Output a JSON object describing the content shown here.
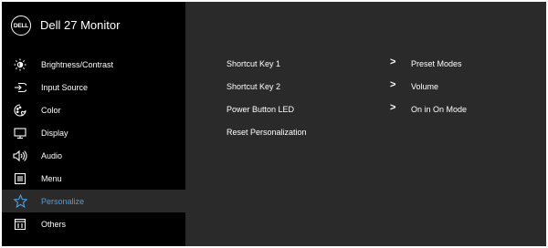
{
  "header": {
    "logo_text": "DELL",
    "title": "Dell 27 Monitor"
  },
  "menu": [
    {
      "label": "Brightness/Contrast",
      "icon": "brightness-icon"
    },
    {
      "label": "Input Source",
      "icon": "input-source-icon"
    },
    {
      "label": "Color",
      "icon": "color-icon"
    },
    {
      "label": "Display",
      "icon": "display-icon"
    },
    {
      "label": "Audio",
      "icon": "audio-icon"
    },
    {
      "label": "Menu",
      "icon": "menu-icon"
    },
    {
      "label": "Personalize",
      "icon": "star-icon",
      "selected": true
    },
    {
      "label": "Others",
      "icon": "others-icon"
    }
  ],
  "panel": {
    "rows": [
      {
        "label": "Shortcut Key 1",
        "arrow": ">",
        "value": "Preset Modes"
      },
      {
        "label": "Shortcut Key 2",
        "arrow": ">",
        "value": "Volume"
      },
      {
        "label": "Power Button LED",
        "arrow": ">",
        "value": "On in On Mode"
      },
      {
        "label": "Reset Personalization",
        "arrow": "",
        "value": ""
      }
    ]
  },
  "colors": {
    "background": "#000000",
    "panel": "#2a2a2a",
    "accent": "#48a0e6",
    "text": "#ffffff"
  }
}
